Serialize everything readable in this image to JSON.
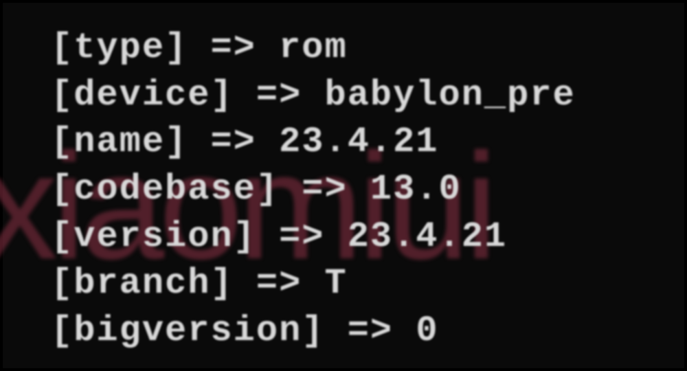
{
  "watermark": "xiaomiui",
  "entries": {
    "type": {
      "key": "type",
      "value": "rom"
    },
    "device": {
      "key": "device",
      "value": "babylon_pre"
    },
    "name": {
      "key": "name",
      "value": "23.4.21"
    },
    "codebase": {
      "key": "codebase",
      "value": "13.0"
    },
    "version": {
      "key": "version",
      "value": "23.4.21"
    },
    "branch": {
      "key": "branch",
      "value": "T"
    },
    "bigversion": {
      "key": "bigversion",
      "value": "0"
    }
  }
}
